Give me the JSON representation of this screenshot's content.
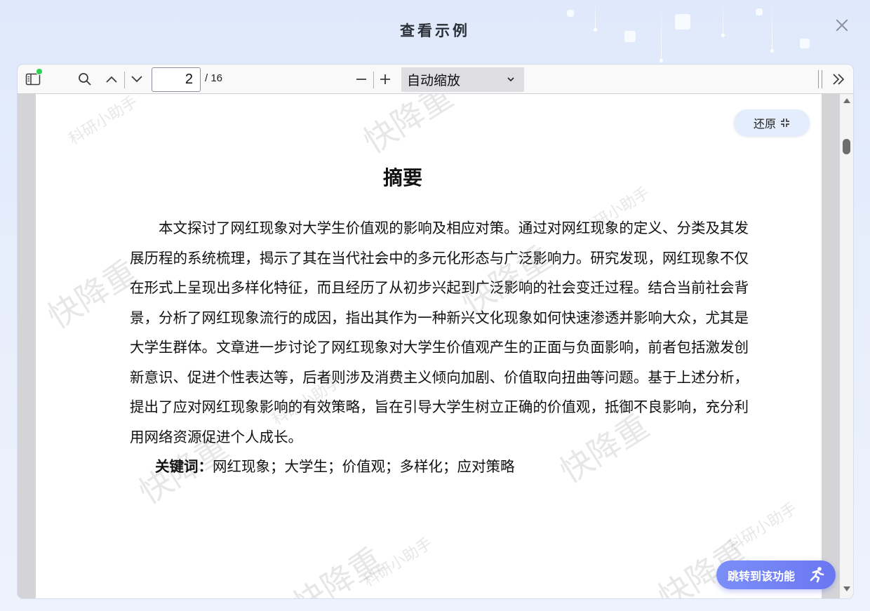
{
  "modal": {
    "title": "查看示例",
    "close_icon": "close-icon"
  },
  "toolbar": {
    "sidebar_icon": "sidebar-toggle-icon",
    "search_icon": "search-icon",
    "prev_icon": "chevron-up-icon",
    "next_icon": "chevron-down-icon",
    "page_current": "2",
    "page_total": "/ 16",
    "zoom_out_icon": "minus-icon",
    "zoom_in_icon": "plus-icon",
    "zoom_value": "自动缩放",
    "more_icon": "double-chevron-right-icon"
  },
  "document": {
    "title": "摘要",
    "body": "本文探讨了网红现象对大学生价值观的影响及相应对策。通过对网红现象的定义、分类及其发展历程的系统梳理，揭示了其在当代社会中的多元化形态与广泛影响力。研究发现，网红现象不仅在形式上呈现出多样化特征，而且经历了从初步兴起到广泛影响的社会变迁过程。结合当前社会背景，分析了网红现象流行的成因，指出其作为一种新兴文化现象如何快速渗透并影响大众，尤其是大学生群体。文章进一步讨论了网红现象对大学生价值观产生的正面与负面影响，前者包括激发创新意识、促进个性表达等，后者则涉及消费主义倾向加剧、价值取向扭曲等问题。基于上述分析，提出了应对网红现象影响的有效策略，旨在引导大学生树立正确的价值观，抵御不良影响，充分利用网络资源促进个人成长。",
    "keywords_label": "关键词：",
    "keywords": "网红现象；大学生；价值观；多样化；应对策略"
  },
  "watermarks": {
    "big": "快降重",
    "small": "科研小助手"
  },
  "buttons": {
    "restore_label": "还原",
    "restore_icon": "collapse-arrows-icon",
    "jump_label": "跳转到该功能",
    "jump_icon": "running-person-icon"
  },
  "colors": {
    "accent": "#6b76f1",
    "status_dot": "#2bd152",
    "restore_bg": "#e4edfb"
  }
}
